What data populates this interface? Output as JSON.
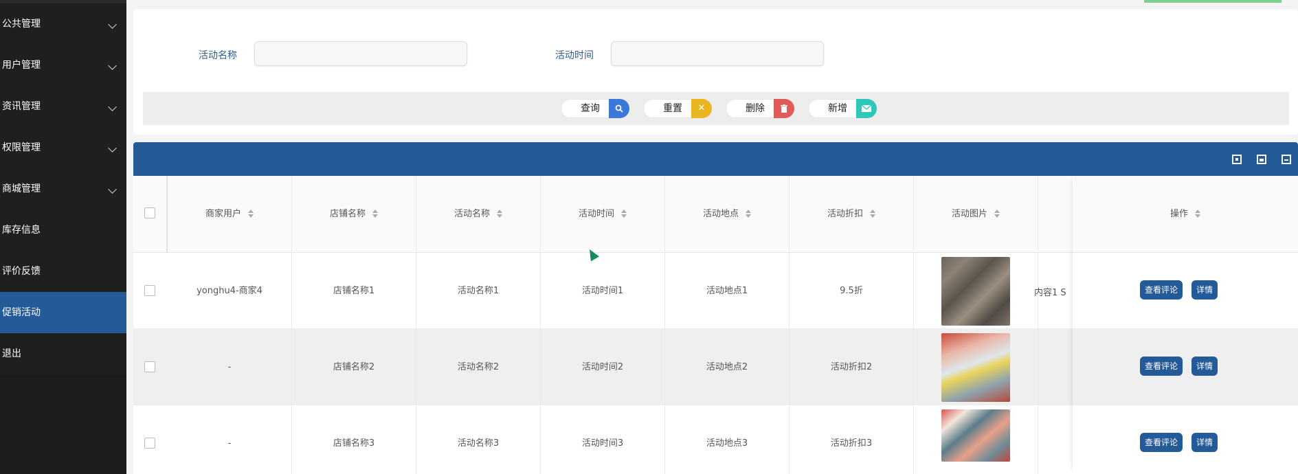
{
  "sidebar": {
    "items": [
      {
        "label": "公共管理",
        "expandable": true
      },
      {
        "label": "用户管理",
        "expandable": true
      },
      {
        "label": "资讯管理",
        "expandable": true
      },
      {
        "label": "权限管理",
        "expandable": true
      },
      {
        "label": "商城管理",
        "expandable": true
      },
      {
        "label": "库存信息",
        "expandable": false
      },
      {
        "label": "评价反馈",
        "expandable": false
      },
      {
        "label": "促销活动",
        "expandable": false,
        "active": true
      },
      {
        "label": "退出",
        "expandable": false
      }
    ]
  },
  "search": {
    "activity_name_label": "活动名称",
    "activity_name_value": "",
    "activity_time_label": "活动时间",
    "activity_time_value": ""
  },
  "buttons": {
    "query": {
      "label": "查询",
      "icon": "search-icon",
      "color": "#3c78d8"
    },
    "reset": {
      "label": "重置",
      "icon": "close-icon",
      "color": "#e9b520"
    },
    "delete": {
      "label": "删除",
      "icon": "trash-icon",
      "color": "#e05a5a"
    },
    "add": {
      "label": "新增",
      "icon": "mail-icon",
      "color": "#2ec7b8"
    }
  },
  "toolbar": {
    "icons": [
      "qr-grid-icon",
      "export-icon",
      "print-icon"
    ]
  },
  "table": {
    "columns": [
      "商家用户",
      "店铺名称",
      "活动名称",
      "活动时间",
      "活动地点",
      "活动折扣",
      "活动图片"
    ],
    "action_header": "操作",
    "rows": [
      {
        "merchant": "yonghu4-商家4",
        "shop": "店铺名称1",
        "name": "活动名称1",
        "time": "活动时间1",
        "location": "活动地点1",
        "discount": "9.5折",
        "image": "shrimp-photo",
        "hidden_col": "内容1 S"
      },
      {
        "merchant": "-",
        "shop": "店铺名称2",
        "name": "活动名称2",
        "time": "活动时间2",
        "location": "活动地点2",
        "discount": "活动折扣2",
        "image": "seafood-ice-photo",
        "hidden_col": ""
      },
      {
        "merchant": "-",
        "shop": "店铺名称3",
        "name": "活动名称3",
        "time": "活动时间3",
        "location": "活动地点3",
        "discount": "活动折扣3",
        "image": "mixed-seafood-photo",
        "hidden_col": ""
      }
    ],
    "row_actions": {
      "comments": "查看评论",
      "detail": "详情"
    }
  },
  "colors": {
    "primary": "#255a99",
    "sidebar_bg": "#1f1f1f",
    "active_bg": "#255a99"
  }
}
